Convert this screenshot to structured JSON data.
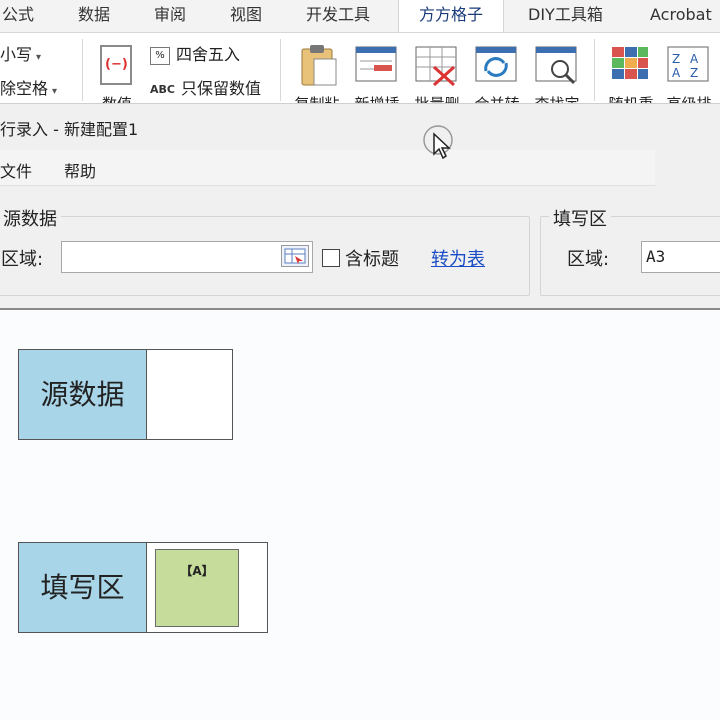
{
  "ribbon_tabs": [
    {
      "label": "公式"
    },
    {
      "label": "数据"
    },
    {
      "label": "审阅"
    },
    {
      "label": "视图"
    },
    {
      "label": "开发工具"
    },
    {
      "label": "方方格子"
    },
    {
      "label": "DIY工具箱"
    },
    {
      "label": "Acrobat"
    }
  ],
  "ribbon": {
    "left_items": {
      "item1": "小写",
      "item2": "除空格"
    },
    "numeric_button": {
      "label": "数值"
    },
    "round_item": {
      "label": "四舍五入",
      "icon_text": "%"
    },
    "keep_values_item": {
      "label": "只保留数值",
      "icon_text": "ABC"
    },
    "buttons": [
      {
        "label": "复制粘"
      },
      {
        "label": "新增插"
      },
      {
        "label": "批量删"
      },
      {
        "label": "合并转"
      },
      {
        "label": "查找定"
      },
      {
        "label": "随机重"
      },
      {
        "label": "高级排"
      }
    ]
  },
  "dialog": {
    "title": "行录入 - 新建配置1",
    "menu": [
      {
        "label": "文件"
      },
      {
        "label": "帮助"
      }
    ],
    "source_group": {
      "title": "源数据",
      "region_label": "区域:",
      "region_value": "",
      "header_checkbox_label": "含标题",
      "header_checked": false,
      "to_table_link": "转为表"
    },
    "fill_group": {
      "title": "填写区",
      "region_label": "区域:",
      "region_value": "A3"
    }
  },
  "sheet": {
    "source_cell_label": "源数据",
    "fill_cell_label": "填写区",
    "fill_cell_marker": "【A】"
  },
  "colors": {
    "label_cell_blue": "#a9d5e8",
    "fill_cell_green": "#c5dc9b",
    "link_blue": "#1a4cc7"
  }
}
